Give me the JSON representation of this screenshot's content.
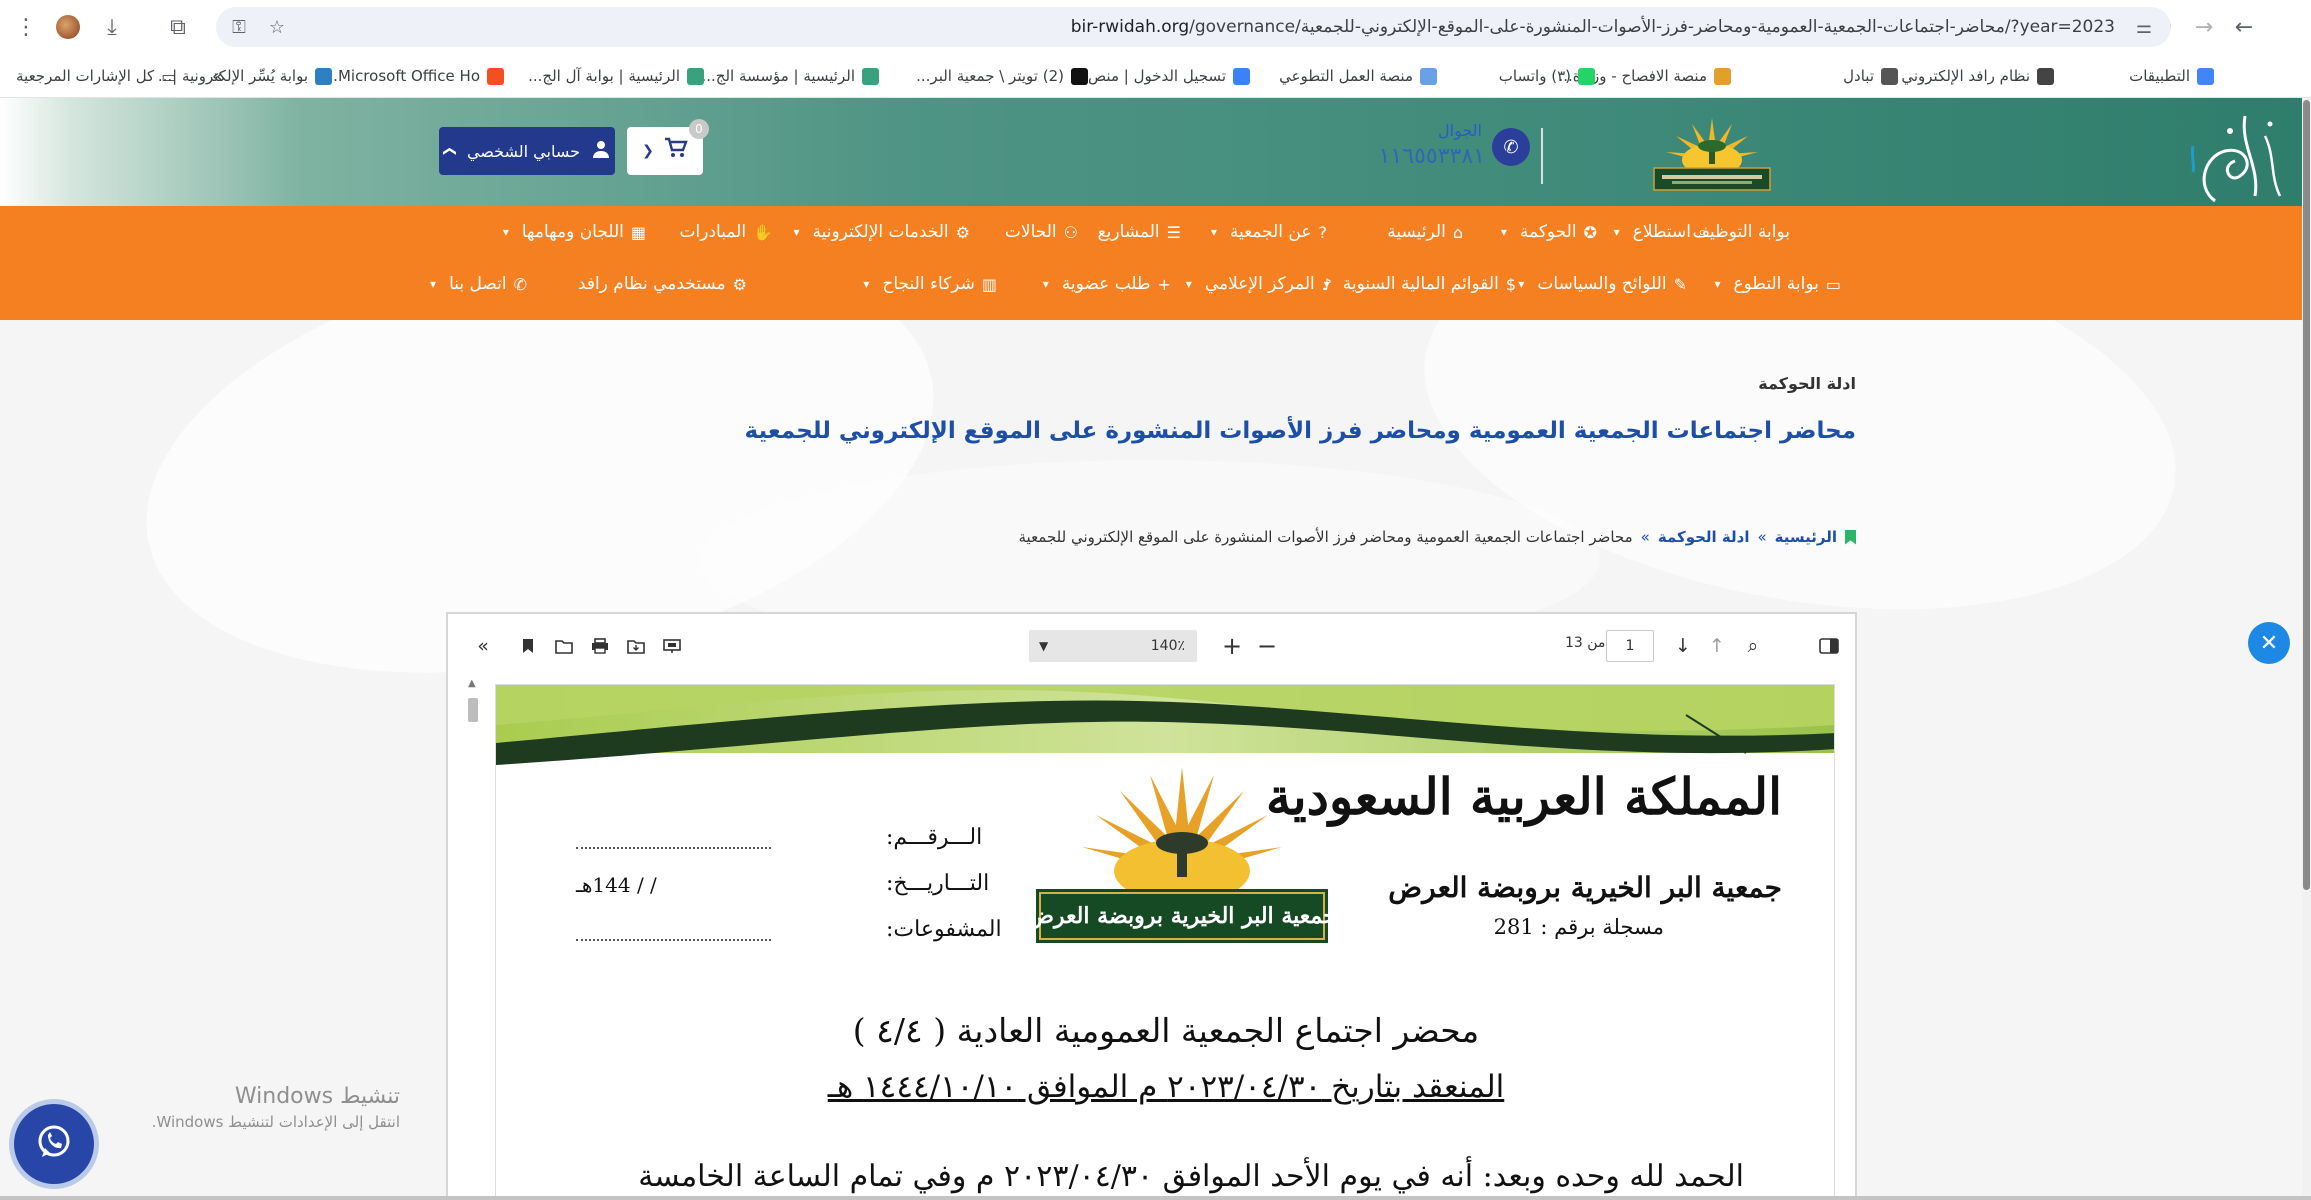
{
  "browser": {
    "url_host": "bir-rwidah.org",
    "url_path": "/governance/محاضر-اجتماعات-الجمعية-العمومية-ومحاضر-فرز-الأصوات-المنشورة-على-الموقع-الإلكتروني-للجمعية/?year=2023",
    "bookmarks": [
      {
        "label": "التطبيقات",
        "color": "#4285f4"
      },
      {
        "label": "نظام رافد الإلكتروني",
        "color": "#444444"
      },
      {
        "label": "تبادل",
        "color": "#555555"
      },
      {
        "label": "منصة الافصاح - وزارة...",
        "color": "#e0a02b"
      },
      {
        "label": "(٣) واتساب",
        "color": "#25d366"
      },
      {
        "label": "منصة العمل التطوعي",
        "color": "#6aa0e6"
      },
      {
        "label": "تسجيل الدخول | منص...",
        "color": "#3b82f6"
      },
      {
        "label": "(2) تويتر \\ جمعية البر...",
        "color": "#111111"
      },
      {
        "label": "الرئيسية | مؤسسة الج...",
        "color": "#3aa17e"
      },
      {
        "label": "الرئيسية | بوابة آل الج...",
        "color": "#3aa17e"
      },
      {
        "label": "Microsoft Office Ho...",
        "color": "#f25022"
      },
      {
        "label": "بوابة يُسِّر الإلكترونية |...",
        "color": "#2f80c3"
      }
    ],
    "bookmarks_overflow": "»",
    "all_bookmarks": "كل الإشارات المرجعية"
  },
  "header": {
    "cart_count": "0",
    "account_label": "حسابي الشخصي",
    "phone_label": "الجوال",
    "phone_number": "١١٦٥٥٣٣٨١"
  },
  "nav": {
    "row1": [
      {
        "label": "بوابة التوظيف",
        "icon": "briefcase-icon",
        "glyph": "",
        "caret": false
      },
      {
        "label": "استطلاع",
        "icon": "search-icon",
        "glyph": "⌕",
        "caret": true
      },
      {
        "label": "الحوكمة",
        "icon": "award-icon",
        "glyph": "✪",
        "caret": true
      },
      {
        "label": "الرئيسية",
        "icon": "home-icon",
        "glyph": "⌂",
        "caret": false
      },
      {
        "label": "عن الجمعية",
        "icon": "question-icon",
        "glyph": "?",
        "caret": true
      },
      {
        "label": "المشاريع",
        "icon": "list-icon",
        "glyph": "☰",
        "caret": false
      },
      {
        "label": "الحالات",
        "icon": "users-icon",
        "glyph": "⚇",
        "caret": false
      },
      {
        "label": "الخدمات الإلكترونية",
        "icon": "cogs-icon",
        "glyph": "⚙",
        "caret": true
      },
      {
        "label": "المبادرات",
        "icon": "handshake-icon",
        "glyph": "✋",
        "caret": false
      },
      {
        "label": "اللجان ومهامها",
        "icon": "grid-icon",
        "glyph": "▦",
        "caret": true
      }
    ],
    "row2": [
      {
        "label": "بوابة التطوع",
        "icon": "card-icon",
        "glyph": "▭",
        "caret": true
      },
      {
        "label": "اللوائح والسياسات",
        "icon": "edit-icon",
        "glyph": "✎",
        "caret": true
      },
      {
        "label": "القوائم المالية السنوية",
        "icon": "dollar-icon",
        "glyph": "$",
        "caret": true
      },
      {
        "label": "المركز الإعلامي",
        "icon": "microphone-icon",
        "glyph": "♪",
        "caret": true
      },
      {
        "label": "طلب عضوية",
        "icon": "plus-icon",
        "glyph": "+",
        "caret": true
      },
      {
        "label": "شركاء النجاح",
        "icon": "building-icon",
        "glyph": "▥",
        "caret": true
      },
      {
        "label": "مستخدمي نظام رافد",
        "icon": "cogs-icon",
        "glyph": "⚙",
        "caret": false
      },
      {
        "label": "اتصل بنا",
        "icon": "phone-icon",
        "glyph": "✆",
        "caret": true
      }
    ]
  },
  "page": {
    "section_label": "ادلة الحوكمة",
    "title": "محاضر اجتماعات الجمعية العمومية ومحاضر فرز الأصوات المنشورة على الموقع الإلكتروني للجمعية",
    "breadcrumb": {
      "home": "الرئيسية",
      "section": "ادلة الحوكمة",
      "current": "محاضر اجتماعات الجمعية العمومية ومحاضر فرز الأصوات المنشورة على الموقع الإلكتروني للجمعية",
      "separator": "»"
    }
  },
  "pdf": {
    "page_number": "1",
    "page_of_label": "من 13",
    "zoom": "140٪",
    "document": {
      "kingdom": "المملكة العربية السعودية",
      "association": "جمعية البر الخيرية بروبضة العرض",
      "registration": "مسجلة برقم : 281",
      "logo_text": "جمعية البر الخيرية بروبضة العرض",
      "number_label": "الـــرقـــم:",
      "date_label": "التـــاريـــخ:",
      "date_value": "/      /      144هـ",
      "attachments_label": "المشفوعات:",
      "heading": "محضر اجتماع الجمعية العمومية العادية ( ٤/٤ )",
      "subheading": "المنعقد بتاريخ ٢٠٢٣/٠٤/٣٠ م الموافق ١٤٤٤/١٠/١٠ هـ",
      "body_line": "الحمد لله وحده وبعد: أنه في يوم الأحد الموافق ٢٠٢٣/٠٤/٣٠ م وفي تمام الساعة الخامسة"
    }
  },
  "overlay": {
    "activation_title": "تنشيط Windows",
    "activation_sub": "انتقل إلى الإعدادات لتنشيط Windows."
  },
  "colors": {
    "nav_orange": "#f58022",
    "brand_blue": "#233a8c",
    "title_blue": "#1e4fa8",
    "header_green": "#3f8a7a"
  }
}
